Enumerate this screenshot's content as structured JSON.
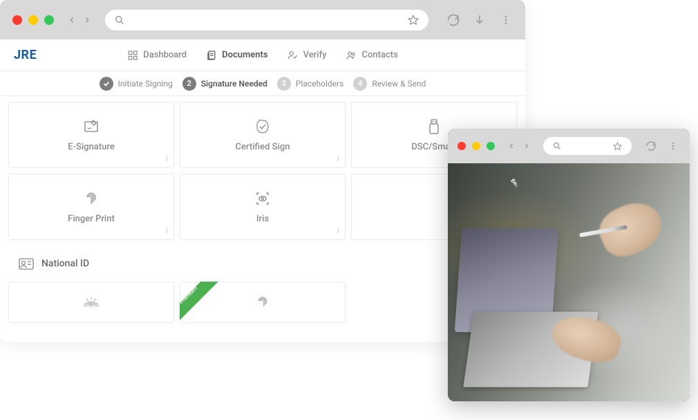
{
  "logo": "JRE",
  "nav": {
    "dashboard": "Dashboard",
    "documents": "Documents",
    "verify": "Verify",
    "contacts": "Contacts"
  },
  "stepper": {
    "step1": {
      "label": "Initiate Signing"
    },
    "step2": {
      "num": "2",
      "label": "Signature Needed"
    },
    "step3": {
      "num": "3",
      "label": "Placeholders"
    },
    "step4": {
      "num": "4",
      "label": "Review & Send"
    }
  },
  "cards": {
    "esign": "E-Signature",
    "certified": "Certified Sign",
    "dsc": "DSC/Smart",
    "fingerprint": "Finger Print",
    "iris": "Iris"
  },
  "ribbons": {
    "beta": "Beta",
    "premium": "Premium"
  },
  "section": {
    "national_id": "National ID"
  }
}
